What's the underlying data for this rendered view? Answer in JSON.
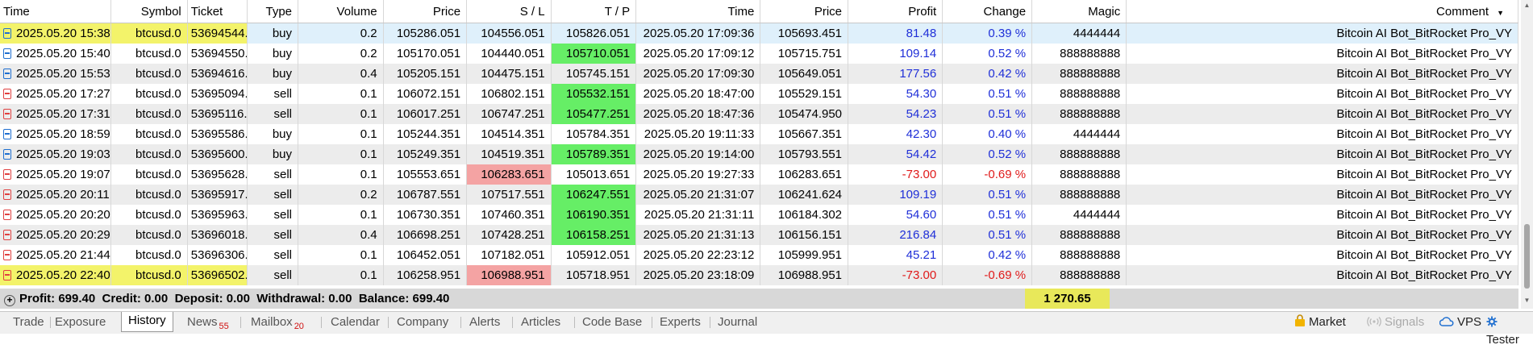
{
  "columns": [
    "Time",
    "Symbol",
    "Ticket",
    "Type",
    "Volume",
    "Price",
    "S / L",
    "T / P",
    "Time",
    "Price",
    "Profit",
    "Change",
    "Magic",
    "Comment"
  ],
  "comment_sort_icon": "triangle-down-icon",
  "rows": [
    {
      "time": "2025.05.20 15:38:...",
      "symbol": "btcusd.0",
      "ticket": "53694544...",
      "type": "buy",
      "volume": "0.2",
      "price": "105286.051",
      "sl": "104556.051",
      "tp": "105826.051",
      "close_time": "2025.05.20 17:09:36",
      "close_price": "105693.451",
      "profit": "81.48",
      "change": "0.39 %",
      "magic": "4444444",
      "comment": "Bitcoin AI Bot_BitRocket Pro_VY"
    },
    {
      "time": "2025.05.20 15:40:...",
      "symbol": "btcusd.0",
      "ticket": "53694550...",
      "type": "buy",
      "volume": "0.2",
      "price": "105170.051",
      "sl": "104440.051",
      "tp": "105710.051",
      "close_time": "2025.05.20 17:09:12",
      "close_price": "105715.751",
      "profit": "109.14",
      "change": "0.52 %",
      "magic": "888888888",
      "comment": "Bitcoin AI Bot_BitRocket Pro_VY"
    },
    {
      "time": "2025.05.20 15:53:...",
      "symbol": "btcusd.0",
      "ticket": "53694616...",
      "type": "buy",
      "volume": "0.4",
      "price": "105205.151",
      "sl": "104475.151",
      "tp": "105745.151",
      "close_time": "2025.05.20 17:09:30",
      "close_price": "105649.051",
      "profit": "177.56",
      "change": "0.42 %",
      "magic": "888888888",
      "comment": "Bitcoin AI Bot_BitRocket Pro_VY"
    },
    {
      "time": "2025.05.20 17:27:...",
      "symbol": "btcusd.0",
      "ticket": "53695094...",
      "type": "sell",
      "volume": "0.1",
      "price": "106072.151",
      "sl": "106802.151",
      "tp": "105532.151",
      "close_time": "2025.05.20 18:47:00",
      "close_price": "105529.151",
      "profit": "54.30",
      "change": "0.51 %",
      "magic": "888888888",
      "comment": "Bitcoin AI Bot_BitRocket Pro_VY"
    },
    {
      "time": "2025.05.20 17:31:...",
      "symbol": "btcusd.0",
      "ticket": "53695116...",
      "type": "sell",
      "volume": "0.1",
      "price": "106017.251",
      "sl": "106747.251",
      "tp": "105477.251",
      "close_time": "2025.05.20 18:47:36",
      "close_price": "105474.950",
      "profit": "54.23",
      "change": "0.51 %",
      "magic": "888888888",
      "comment": "Bitcoin AI Bot_BitRocket Pro_VY"
    },
    {
      "time": "2025.05.20 18:59:...",
      "symbol": "btcusd.0",
      "ticket": "53695586...",
      "type": "buy",
      "volume": "0.1",
      "price": "105244.351",
      "sl": "104514.351",
      "tp": "105784.351",
      "close_time": "2025.05.20 19:11:33",
      "close_price": "105667.351",
      "profit": "42.30",
      "change": "0.40 %",
      "magic": "4444444",
      "comment": "Bitcoin AI Bot_BitRocket Pro_VY"
    },
    {
      "time": "2025.05.20 19:03:...",
      "symbol": "btcusd.0",
      "ticket": "53695600...",
      "type": "buy",
      "volume": "0.1",
      "price": "105249.351",
      "sl": "104519.351",
      "tp": "105789.351",
      "close_time": "2025.05.20 19:14:00",
      "close_price": "105793.551",
      "profit": "54.42",
      "change": "0.52 %",
      "magic": "888888888",
      "comment": "Bitcoin AI Bot_BitRocket Pro_VY"
    },
    {
      "time": "2025.05.20 19:07:...",
      "symbol": "btcusd.0",
      "ticket": "53695628...",
      "type": "sell",
      "volume": "0.1",
      "price": "105553.651",
      "sl": "106283.651",
      "tp": "105013.651",
      "close_time": "2025.05.20 19:27:33",
      "close_price": "106283.651",
      "profit": "-73.00",
      "change": "-0.69 %",
      "magic": "888888888",
      "comment": "Bitcoin AI Bot_BitRocket Pro_VY"
    },
    {
      "time": "2025.05.20 20:11:...",
      "symbol": "btcusd.0",
      "ticket": "53695917...",
      "type": "sell",
      "volume": "0.2",
      "price": "106787.551",
      "sl": "107517.551",
      "tp": "106247.551",
      "close_time": "2025.05.20 21:31:07",
      "close_price": "106241.624",
      "profit": "109.19",
      "change": "0.51 %",
      "magic": "888888888",
      "comment": "Bitcoin AI Bot_BitRocket Pro_VY"
    },
    {
      "time": "2025.05.20 20:20:...",
      "symbol": "btcusd.0",
      "ticket": "53695963...",
      "type": "sell",
      "volume": "0.1",
      "price": "106730.351",
      "sl": "107460.351",
      "tp": "106190.351",
      "close_time": "2025.05.20 21:31:11",
      "close_price": "106184.302",
      "profit": "54.60",
      "change": "0.51 %",
      "magic": "4444444",
      "comment": "Bitcoin AI Bot_BitRocket Pro_VY"
    },
    {
      "time": "2025.05.20 20:29:...",
      "symbol": "btcusd.0",
      "ticket": "53696018...",
      "type": "sell",
      "volume": "0.4",
      "price": "106698.251",
      "sl": "107428.251",
      "tp": "106158.251",
      "close_time": "2025.05.20 21:31:13",
      "close_price": "106156.151",
      "profit": "216.84",
      "change": "0.51 %",
      "magic": "888888888",
      "comment": "Bitcoin AI Bot_BitRocket Pro_VY"
    },
    {
      "time": "2025.05.20 21:44:...",
      "symbol": "btcusd.0",
      "ticket": "53696306...",
      "type": "sell",
      "volume": "0.1",
      "price": "106452.051",
      "sl": "107182.051",
      "tp": "105912.051",
      "close_time": "2025.05.20 22:23:12",
      "close_price": "105999.951",
      "profit": "45.21",
      "change": "0.42 %",
      "magic": "888888888",
      "comment": "Bitcoin AI Bot_BitRocket Pro_VY"
    },
    {
      "time": "2025.05.20 22:40:...",
      "symbol": "btcusd.0",
      "ticket": "53696502...",
      "type": "sell",
      "volume": "0.1",
      "price": "106258.951",
      "sl": "106988.951",
      "tp": "105718.951",
      "close_time": "2025.05.20 23:18:09",
      "close_price": "106988.951",
      "profit": "-73.00",
      "change": "-0.69 %",
      "magic": "888888888",
      "comment": "Bitcoin AI Bot_BitRocket Pro_VY"
    }
  ],
  "summary": {
    "text": "Profit: 699.40  Credit: 0.00  Deposit: 0.00  Withdrawal: 0.00  Balance: 699.40",
    "total_profit": "1 270.65",
    "expand_icon": "plus-circle-icon"
  },
  "tabs": [
    {
      "label": "Trade"
    },
    {
      "label": "Exposure"
    },
    {
      "label": "History",
      "active": true
    },
    {
      "label": "News",
      "badge": "55"
    },
    {
      "label": "Mailbox",
      "badge": "20"
    },
    {
      "label": "Calendar"
    },
    {
      "label": "Company"
    },
    {
      "label": "Alerts"
    },
    {
      "label": "Articles"
    },
    {
      "label": "Code Base"
    },
    {
      "label": "Experts"
    },
    {
      "label": "Journal"
    }
  ],
  "right_items": [
    {
      "label": "Market",
      "icon": "lock-bag-icon"
    },
    {
      "label": "Signals",
      "icon": "signal-icon",
      "dim": true
    },
    {
      "label": "VPS",
      "icon": "cloud-icon"
    },
    {
      "label": "Tester",
      "icon": "gear-icon"
    }
  ],
  "colors": {
    "tp_hit": "#66ee66",
    "sl_hit": "#f4a3a3",
    "highlight": "#f3f36a",
    "profit_positive": "#1f2fd8",
    "profit_negative": "#e01a1a",
    "selected_row": "#dff0fb",
    "summary_bg": "#d8d8d8"
  }
}
